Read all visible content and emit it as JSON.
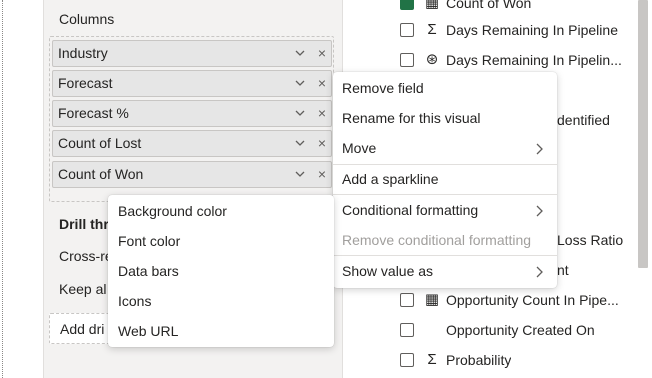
{
  "visualizations_pane": {
    "columns_title": "Columns",
    "column_fields": [
      {
        "label": "Industry"
      },
      {
        "label": "Forecast"
      },
      {
        "label": "Forecast %"
      },
      {
        "label": "Count of Lost"
      },
      {
        "label": "Count of Won"
      }
    ],
    "remove_glyph": "×",
    "drill_through_partial": "Drill thr",
    "cross_report_partial": "Cross-re",
    "keep_all_partial": "Keep al",
    "add_drill_partial": "Add dri"
  },
  "fields_pane": {
    "rows": [
      {
        "label": "Count of Won",
        "icon": "calculator-icon",
        "glyph": "▦",
        "checked": true
      },
      {
        "label": "Days Remaining In Pipeline",
        "icon": "sigma-icon",
        "glyph": "Σ",
        "checked": false
      },
      {
        "label": "Days Remaining In Pipelin...",
        "icon": "hierarchy-icon",
        "glyph": "⊛",
        "checked": false
      },
      {
        "label": "Opportunity Count In Pipe...",
        "icon": "calculator-icon",
        "glyph": "▦",
        "checked": false
      },
      {
        "label": "Opportunity Created On",
        "icon": "",
        "glyph": "",
        "checked": false
      },
      {
        "label": "Probability",
        "icon": "sigma-icon",
        "glyph": "Σ",
        "checked": false
      }
    ],
    "partial_dentified": "dentified",
    "partial_loss_ratio": "Loss Ratio",
    "partial_nt": "nt"
  },
  "context_menu": {
    "items": [
      {
        "label": "Remove field",
        "has_submenu": false,
        "disabled": false
      },
      {
        "label": "Rename for this visual",
        "has_submenu": false,
        "disabled": false
      },
      {
        "label": "Move",
        "has_submenu": true,
        "disabled": false
      },
      {
        "label": "Add a sparkline",
        "has_submenu": false,
        "disabled": false
      },
      {
        "label": "Conditional formatting",
        "has_submenu": true,
        "disabled": false
      },
      {
        "label": "Remove conditional formatting",
        "has_submenu": false,
        "disabled": true
      },
      {
        "label": "Show value as",
        "has_submenu": true,
        "disabled": false
      }
    ]
  },
  "submenu": {
    "items": [
      {
        "label": "Background color"
      },
      {
        "label": "Font color"
      },
      {
        "label": "Data bars"
      },
      {
        "label": "Icons"
      },
      {
        "label": "Web URL"
      }
    ]
  },
  "colors": {
    "pane_background": "#f3f2f1",
    "pill_background": "#e6e6e6",
    "checkbox_checked": "#217346",
    "disabled_text": "#a19f9d"
  }
}
